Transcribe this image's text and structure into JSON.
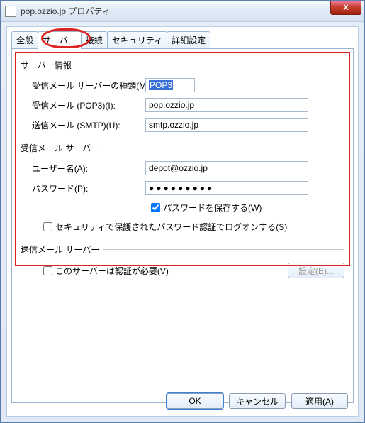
{
  "window": {
    "title": "pop.ozzio.jp プロパティ",
    "close": "X"
  },
  "tabs": {
    "general": "全般",
    "server": "サーバー",
    "connection": "接続",
    "security": "セキュリティ",
    "advanced": "詳細設定"
  },
  "server_info": {
    "header": "サーバー情報",
    "incoming_type_label": "受信メール サーバーの種類(M):",
    "incoming_type_value": "POP3",
    "incoming_pop3_label": "受信メール (POP3)(I):",
    "incoming_pop3_value": "pop.ozzio.jp",
    "outgoing_smtp_label": "送信メール (SMTP)(U):",
    "outgoing_smtp_value": "smtp.ozzio.jp"
  },
  "incoming_server": {
    "header": "受信メール サーバー",
    "username_label": "ユーザー名(A):",
    "username_value": "depot@ozzio.jp",
    "password_label": "パスワード(P):",
    "password_value": "●●●●●●●●●",
    "remember_pw_label": "パスワードを保存する(W)",
    "remember_pw_checked": true,
    "spa_label": "セキュリティで保護されたパスワード認証でログオンする(S)",
    "spa_checked": false
  },
  "outgoing_server": {
    "header": "送信メール サーバー",
    "auth_required_label": "このサーバーは認証が必要(V)",
    "auth_required_checked": false,
    "settings_button": "設定(E)..."
  },
  "buttons": {
    "ok": "OK",
    "cancel": "キャンセル",
    "apply": "適用(A)"
  }
}
